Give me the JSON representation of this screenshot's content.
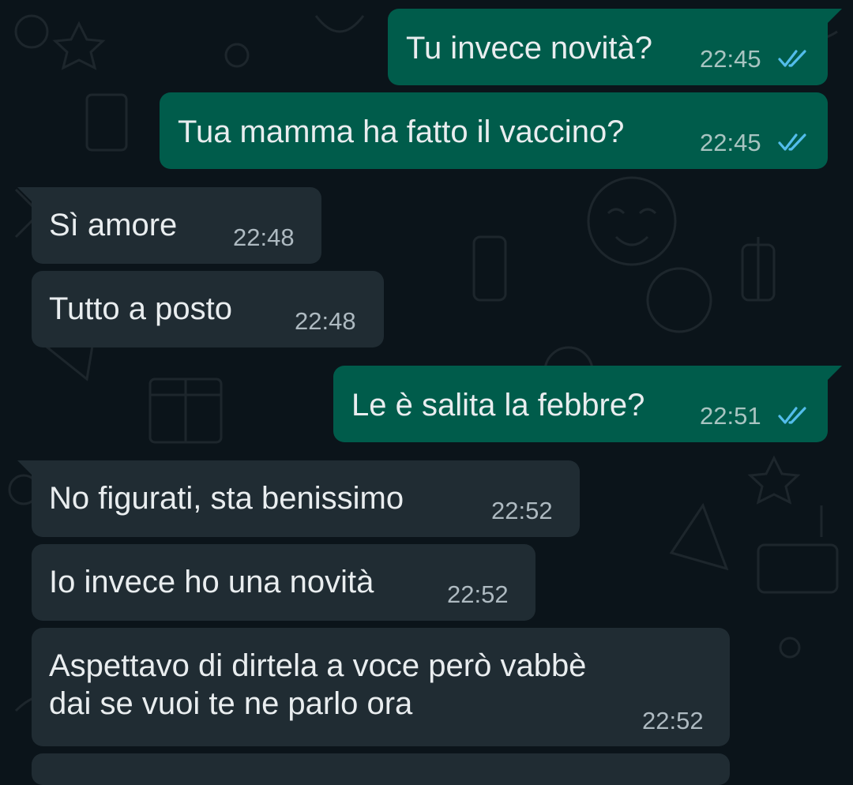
{
  "colors": {
    "background": "#0b141a",
    "outgoing_bubble": "#005c4b",
    "incoming_bubble": "#202c33",
    "text": "#e9edef",
    "read_ticks": "#53bdeb"
  },
  "messages": [
    {
      "direction": "outgoing",
      "text": "Tu invece novità?",
      "time": "22:45",
      "status": "read"
    },
    {
      "direction": "outgoing",
      "text": "Tua mamma ha fatto il vaccino?",
      "time": "22:45",
      "status": "read"
    },
    {
      "direction": "incoming",
      "text": "Sì amore",
      "time": "22:48"
    },
    {
      "direction": "incoming",
      "text": "Tutto a posto",
      "time": "22:48"
    },
    {
      "direction": "outgoing",
      "text": "Le è salita la febbre?",
      "time": "22:51",
      "status": "read"
    },
    {
      "direction": "incoming",
      "text": "No figurati, sta benissimo",
      "time": "22:52"
    },
    {
      "direction": "incoming",
      "text": "Io invece ho una novità",
      "time": "22:52"
    },
    {
      "direction": "incoming",
      "text": "Aspettavo di dirtela a voce però vabbè\ndai se vuoi te ne parlo ora",
      "time": "22:52"
    }
  ]
}
